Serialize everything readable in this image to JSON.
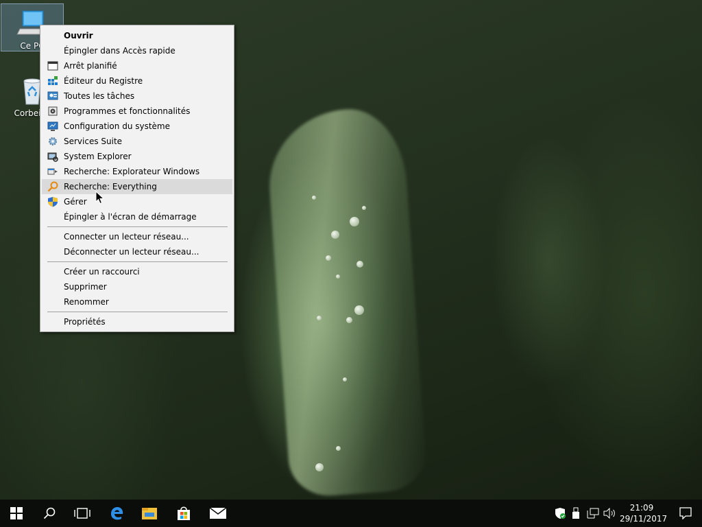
{
  "desktop": {
    "icons": [
      {
        "label": "Ce PC",
        "icon": "computer-icon"
      },
      {
        "label": "Corbeille",
        "icon": "recycle-bin-icon"
      }
    ]
  },
  "context_menu": {
    "groups": [
      [
        {
          "label": "Ouvrir",
          "bold": true
        },
        {
          "label": "Épingler dans Accès rapide"
        },
        {
          "label": "Arrêt planifié",
          "icon": "window-icon"
        },
        {
          "label": "Éditeur du Registre",
          "icon": "registry-icon"
        },
        {
          "label": "Toutes les tâches",
          "icon": "control-panel-icon"
        },
        {
          "label": "Programmes et fonctionnalités",
          "icon": "programs-icon"
        },
        {
          "label": "Configuration du système",
          "icon": "msconfig-icon"
        },
        {
          "label": "Services Suite",
          "icon": "services-gear-icon"
        },
        {
          "label": "System Explorer",
          "icon": "system-explorer-icon"
        },
        {
          "label": "Recherche: Explorateur Windows",
          "icon": "explorer-search-icon"
        },
        {
          "label": "Recherche: Everything",
          "icon": "everything-search-icon",
          "highlighted": true
        },
        {
          "label": "Gérer",
          "icon": "uac-shield-icon"
        },
        {
          "label": "Épingler à l'écran de démarrage"
        }
      ],
      [
        {
          "label": "Connecter un lecteur réseau..."
        },
        {
          "label": "Déconnecter un lecteur réseau..."
        }
      ],
      [
        {
          "label": "Créer un raccourci"
        },
        {
          "label": "Supprimer"
        },
        {
          "label": "Renommer"
        }
      ],
      [
        {
          "label": "Propriétés"
        }
      ]
    ]
  },
  "taskbar": {
    "buttons": [
      "start-icon",
      "search-icon",
      "task-view-icon",
      "edge-icon",
      "file-explorer-icon",
      "store-icon",
      "mail-icon"
    ],
    "tray": [
      "defender-icon",
      "usb-icon",
      "network-icon",
      "volume-icon"
    ],
    "clock": {
      "time": "21:09",
      "date": "29/11/2017"
    },
    "notification_icon": "action-center-icon"
  },
  "colors": {
    "menu_bg": "#f2f2f2",
    "menu_hover": "#dadada",
    "taskbar": "#0a0d0a"
  }
}
